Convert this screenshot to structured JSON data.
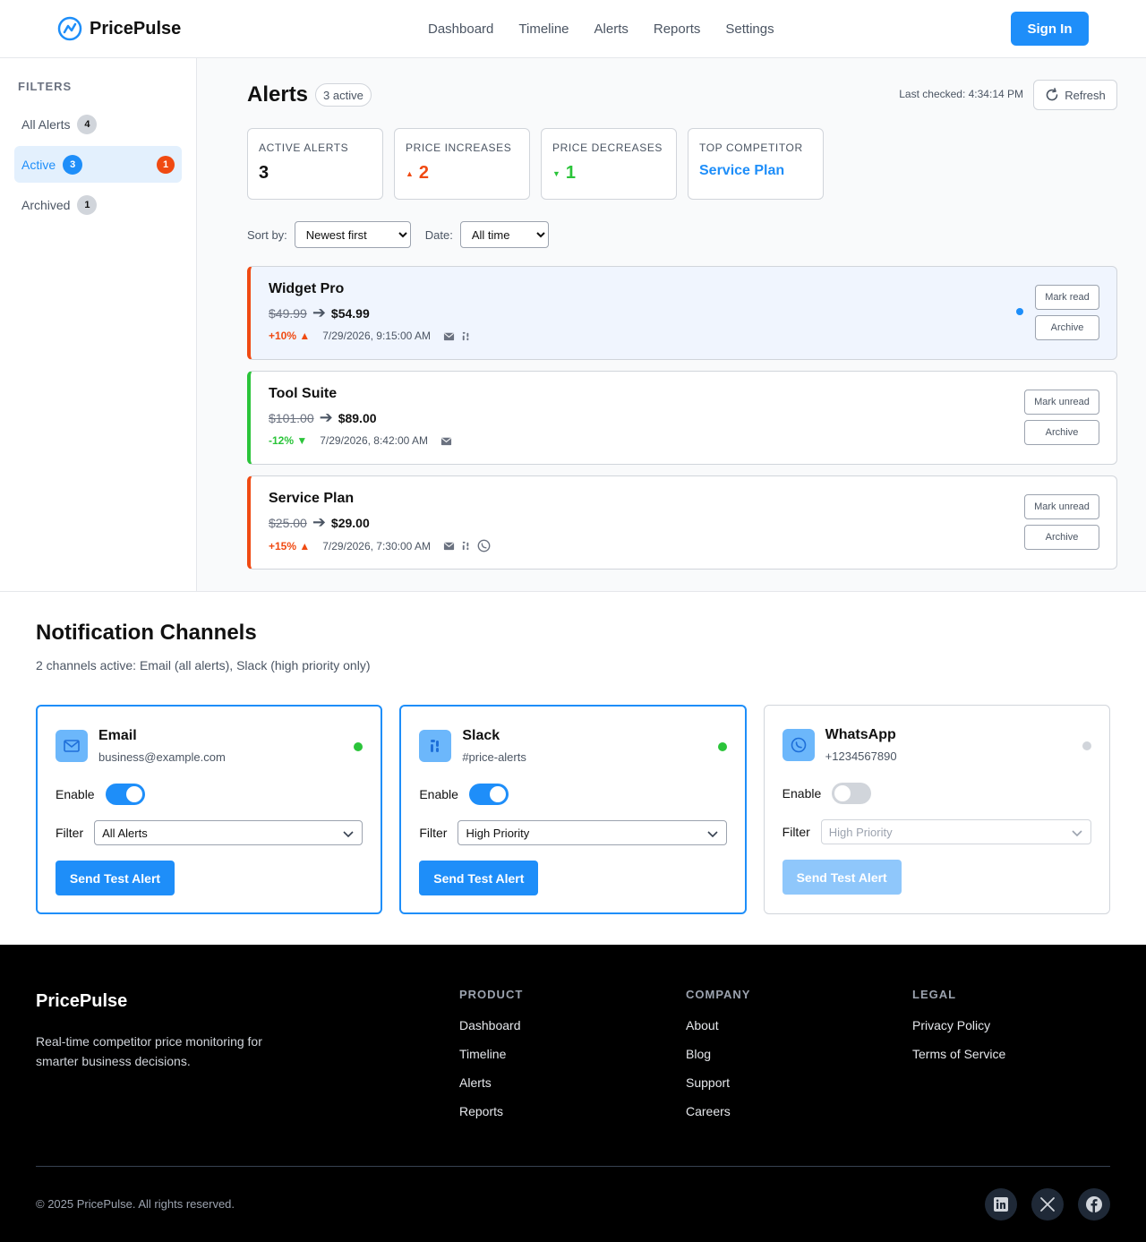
{
  "header": {
    "brand": "PricePulse",
    "nav": [
      "Dashboard",
      "Timeline",
      "Alerts",
      "Reports",
      "Settings"
    ],
    "signin_label": "Sign In"
  },
  "sidebar": {
    "title": "FILTERS",
    "items": [
      {
        "label": "All Alerts",
        "count": "4"
      },
      {
        "label": "Active",
        "count": "3",
        "unread": "1"
      },
      {
        "label": "Archived",
        "count": "1"
      }
    ]
  },
  "main": {
    "title": "Alerts",
    "badge": "3 active",
    "last_checked": "Last checked: 4:34:14 PM",
    "refresh_label": "Refresh",
    "stats": [
      {
        "label": "ACTIVE ALERTS",
        "value": "3"
      },
      {
        "label": "PRICE INCREASES",
        "value": "2"
      },
      {
        "label": "PRICE DECREASES",
        "value": "1"
      },
      {
        "label": "TOP COMPETITOR",
        "value": "Service Plan"
      }
    ],
    "sort_label": "Sort by:",
    "sort_value": "Newest first",
    "date_label": "Date:",
    "date_value": "All time",
    "alerts": [
      {
        "name": "Widget Pro",
        "old": "$49.99",
        "new": "$54.99",
        "change": "+10% ▲",
        "time": "7/29/2026, 9:15:00 AM",
        "btn1": "Mark read",
        "btn2": "Archive"
      },
      {
        "name": "Tool Suite",
        "old": "$101.00",
        "new": "$89.00",
        "change": "-12% ▼",
        "time": "7/29/2026, 8:42:00 AM",
        "btn1": "Mark unread",
        "btn2": "Archive"
      },
      {
        "name": "Service Plan",
        "old": "$25.00",
        "new": "$29.00",
        "change": "+15% ▲",
        "time": "7/29/2026, 7:30:00 AM",
        "btn1": "Mark unread",
        "btn2": "Archive"
      }
    ]
  },
  "channels": {
    "title": "Notification Channels",
    "subtitle": "2 channels active: Email (all alerts), Slack (high priority only)",
    "enable_label": "Enable",
    "filter_label": "Filter",
    "send_label": "Send Test Alert",
    "cards": [
      {
        "name": "Email",
        "detail": "business@example.com",
        "filter": "All Alerts"
      },
      {
        "name": "Slack",
        "detail": "#price-alerts",
        "filter": "High Priority"
      },
      {
        "name": "WhatsApp",
        "detail": "+1234567890",
        "filter": "High Priority"
      }
    ]
  },
  "footer": {
    "brand": "PricePulse",
    "desc": "Real-time competitor price monitoring for smarter business decisions.",
    "cols": [
      {
        "title": "PRODUCT",
        "links": [
          "Dashboard",
          "Timeline",
          "Alerts",
          "Reports"
        ]
      },
      {
        "title": "COMPANY",
        "links": [
          "About",
          "Blog",
          "Support",
          "Careers"
        ]
      },
      {
        "title": "LEGAL",
        "links": [
          "Privacy Policy",
          "Terms of Service"
        ]
      }
    ],
    "copyright": "© 2025 PricePulse. All rights reserved."
  },
  "colors": {
    "accent": "#1e8ef9",
    "increase": "#f04a12",
    "decrease": "#2bc43a"
  }
}
